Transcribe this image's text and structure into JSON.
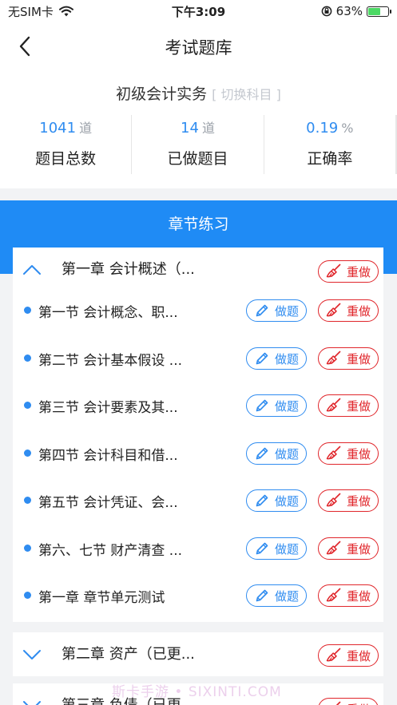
{
  "status": {
    "carrier": "无SIM卡",
    "time": "下午3:09",
    "battery": "63%",
    "battery_level": 0.63
  },
  "nav": {
    "title": "考试题库"
  },
  "summary": {
    "subject": "初级会计实务",
    "switch_label": "[ 切换科目 ]",
    "stats": [
      {
        "value": "1041",
        "unit": "道",
        "label": "题目总数"
      },
      {
        "value": "14",
        "unit": "道",
        "label": "已做题目"
      },
      {
        "value": "0.19",
        "unit": "%",
        "label": "正确率"
      }
    ]
  },
  "section_header": "章节练习",
  "buttons": {
    "do": "做题",
    "redo": "重做"
  },
  "chapters": [
    {
      "title": "第一章 会计概述（...",
      "expanded": true
    },
    {
      "title": "第二章 资产（已更...",
      "expanded": false
    },
    {
      "title": "第三章 负债（已更...",
      "expanded": false
    }
  ],
  "sections": [
    "第一节 会计概念、职...",
    "第二节 会计基本假设 ...",
    "第三节 会计要素及其...",
    "第四节 会计科目和借...",
    "第五节 会计凭证、会...",
    "第六、七节 财产清查 ...",
    "第一章 章节单元测试"
  ],
  "watermark": "斯卡手游 • SIXINTI.COM",
  "colors": {
    "accent": "#1f8bf5",
    "redo": "#e0262b",
    "bg": "#f2f3f5"
  }
}
